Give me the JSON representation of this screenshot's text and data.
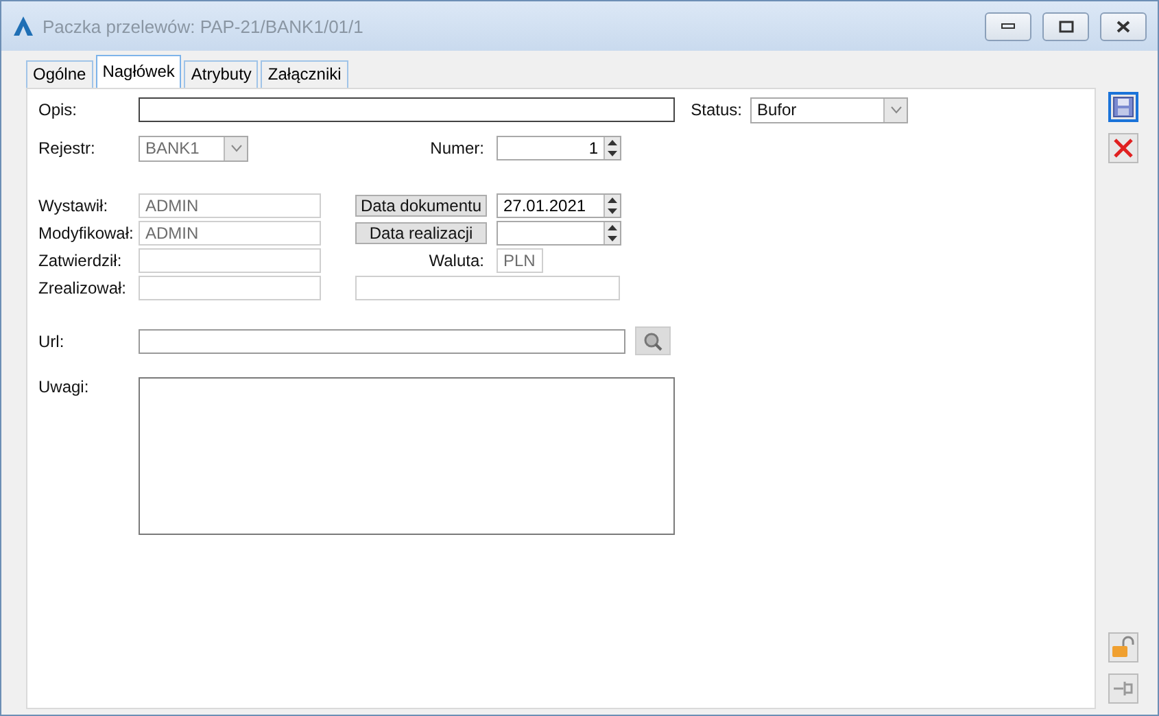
{
  "window": {
    "title": "Paczka przelewów: PAP-21/BANK1/01/1"
  },
  "tabs": [
    {
      "label": "Ogólne",
      "selected": false
    },
    {
      "label": "Nagłówek",
      "selected": true
    },
    {
      "label": "Atrybuty",
      "selected": false
    },
    {
      "label": "Załączniki",
      "selected": false
    }
  ],
  "opis": {
    "label": "Opis:"
  },
  "status": {
    "label": "Status:",
    "value": "Bufor"
  },
  "rejestr": {
    "label": "Rejestr:",
    "value": "BANK1",
    "disabled": true
  },
  "numer": {
    "label": "Numer:",
    "value": "1"
  },
  "people": [
    {
      "label": "Wystawił:",
      "value": "ADMIN",
      "disabled": true
    },
    {
      "label": "Modyfikował:",
      "value": "ADMIN",
      "disabled": true
    },
    {
      "label": "Zatwierdził:",
      "disabled": true
    },
    {
      "label": "Zrealizował:",
      "disabled": true
    }
  ],
  "dates": [
    {
      "button": "Data dokumentu",
      "value": "27.01.2021"
    },
    {
      "button": "Data realizacji"
    }
  ],
  "waluta": {
    "label": "Waluta:",
    "value": "PLN",
    "disabled": true
  },
  "url": {
    "label": "Url:"
  },
  "uwagi": {
    "label": "Uwagi:"
  }
}
